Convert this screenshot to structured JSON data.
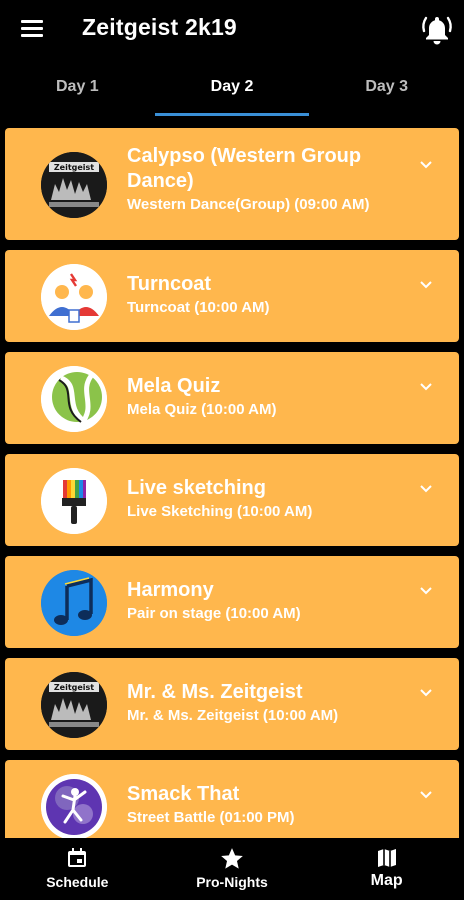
{
  "app": {
    "title": "Zeitgeist 2k19"
  },
  "tabs": [
    {
      "label": "Day 1",
      "active": false
    },
    {
      "label": "Day 2",
      "active": true
    },
    {
      "label": "Day 3",
      "active": false
    }
  ],
  "events": [
    {
      "title": "Calypso (Western Group Dance)",
      "subtitle": "Western Dance(Group) (09:00 AM)",
      "icon": "zeitgeist-logo-icon"
    },
    {
      "title": "Turncoat",
      "subtitle": "Turncoat (10:00 AM)",
      "icon": "debate-people-icon"
    },
    {
      "title": "Mela Quiz",
      "subtitle": "Mela Quiz (10:00 AM)",
      "icon": "tennis-ball-icon"
    },
    {
      "title": "Live sketching",
      "subtitle": "Live Sketching (10:00 AM)",
      "icon": "paintbrush-icon"
    },
    {
      "title": "Harmony",
      "subtitle": "Pair on stage (10:00 AM)",
      "icon": "music-note-icon"
    },
    {
      "title": "Mr. & Ms. Zeitgeist",
      "subtitle": "Mr. & Ms. Zeitgeist (10:00 AM)",
      "icon": "zeitgeist-logo-icon"
    },
    {
      "title": "Smack That",
      "subtitle": "Street Battle (01:00 PM)",
      "icon": "dancer-icon"
    }
  ],
  "bottom_nav": [
    {
      "label": "Schedule",
      "icon": "calendar-icon"
    },
    {
      "label": "Pro-Nights",
      "icon": "star-icon"
    },
    {
      "label": "Map",
      "icon": "map-icon"
    }
  ],
  "colors": {
    "card": "#ffb74d",
    "tab_indicator": "#3a8fd6",
    "background": "#000000"
  }
}
